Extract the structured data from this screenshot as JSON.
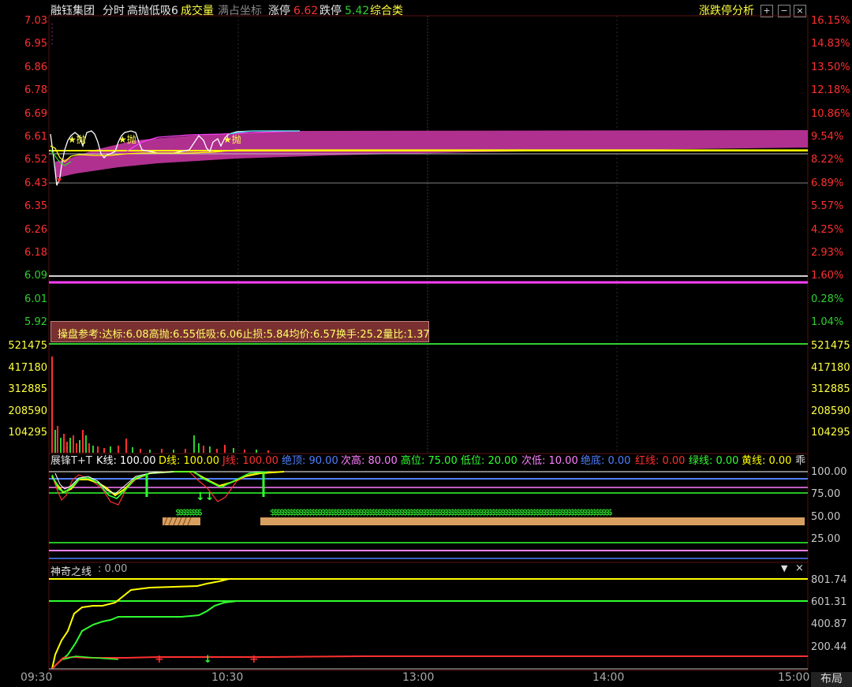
{
  "header": {
    "stock_name": "融钰集团",
    "mode": "分时",
    "indicator": "高抛低吸6",
    "volume": "成交量",
    "full_coord": "满占坐标",
    "limit_up_label": "涨停",
    "limit_up_value": "6.62",
    "limit_down_label": "跌停",
    "limit_down_value": "5.42",
    "category": "综合类",
    "analysis": "涨跌停分析"
  },
  "price_axis_left": [
    "7.03",
    "6.95",
    "6.86",
    "6.78",
    "6.69",
    "6.61",
    "6.52",
    "6.43",
    "6.35",
    "6.26",
    "6.18",
    "6.09",
    "6.01",
    "5.92"
  ],
  "price_axis_right": [
    "16.15%",
    "14.83%",
    "13.50%",
    "12.18%",
    "10.86%",
    "9.54%",
    "8.22%",
    "6.89%",
    "5.57%",
    "4.25%",
    "2.93%",
    "1.60%",
    "0.28%",
    "1.04%"
  ],
  "reference_box": "操盘参考:达标:6.08高抛:6.55低吸:6.06止损:5.84均价:6.57换手:25.2量比:1.37",
  "markers": {
    "sell": "抛"
  },
  "volume_axis": [
    "521475",
    "417180",
    "312885",
    "208590",
    "104295"
  ],
  "indicator1": {
    "name": "展锋T+T",
    "items": [
      {
        "label": "K线: 100.00",
        "color": "#ffffff"
      },
      {
        "label": "D线: 100.00",
        "color": "#ffff00"
      },
      {
        "label": "J线: 100.00",
        "color": "#ff3030"
      },
      {
        "label": "绝顶: 90.00",
        "color": "#5080ff"
      },
      {
        "label": "次高: 80.00",
        "color": "#ff80ff"
      },
      {
        "label": "高位: 75.00",
        "color": "#30ff30"
      },
      {
        "label": "低位: 20.00",
        "color": "#30ff30"
      },
      {
        "label": "次低: 10.00",
        "color": "#ff80ff"
      },
      {
        "label": "绝底: 0.00",
        "color": "#5080ff"
      },
      {
        "label": "红线: 0.00",
        "color": "#ff3030"
      },
      {
        "label": "绿线: 0.00",
        "color": "#30ff30"
      },
      {
        "label": "黄线: 0.00",
        "color": "#ffff00"
      }
    ],
    "extra": "乖",
    "axis": [
      "100.00",
      "75.00",
      "50.00",
      "25.00"
    ],
    "s_marks": "$$$$$$$$$$$$$$$$$$$$$$$$$$$$$$$$$$$$$$$$$$$$$$$$$$$$$$$$$$$$$$$$$$$$$$$$$$$$$$$$$$$$$$$$$$$$$$$$$$$$$$$$$$$$",
    "s_marks_short": "$$$$$$$$"
  },
  "indicator2": {
    "name": "神奇之线",
    "value": ": 0.00",
    "axis": [
      "801.74",
      "601.31",
      "400.87",
      "200.44"
    ]
  },
  "time_axis": [
    "09:30",
    "10:30",
    "13:00",
    "14:00",
    "15:00"
  ],
  "layout_button": "布局",
  "colors": {
    "up": "#ff3030",
    "down": "#30d030",
    "yellow": "#ffff00",
    "magenta": "#ff40ff",
    "fill": "#b03090"
  }
}
